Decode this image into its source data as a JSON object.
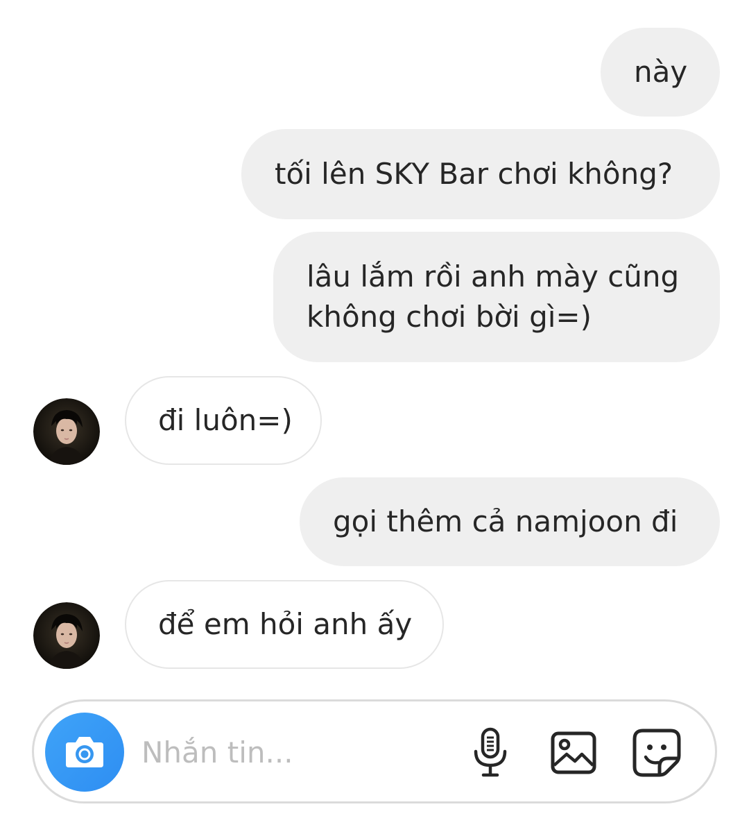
{
  "messages": [
    {
      "direction": "outgoing",
      "text": "này"
    },
    {
      "direction": "outgoing",
      "text": "tối lên SKY Bar chơi không?"
    },
    {
      "direction": "outgoing",
      "line1": "lâu lắm rồi anh mày cũng",
      "line2": "không chơi bời gì=)"
    },
    {
      "direction": "incoming",
      "text": "đi luôn=)"
    },
    {
      "direction": "outgoing",
      "text": "gọi thêm cả namjoon đi"
    },
    {
      "direction": "incoming",
      "text": "để em hỏi anh ấy"
    }
  ],
  "composer": {
    "placeholder": "Nhắn tin...",
    "icons": [
      "camera-icon",
      "microphone-icon",
      "gallery-icon",
      "sticker-icon"
    ]
  },
  "colors": {
    "outgoing_bubble": "#efefef",
    "incoming_border": "#e6e6e6",
    "camera_button": "#3797f0",
    "text": "#262626"
  }
}
